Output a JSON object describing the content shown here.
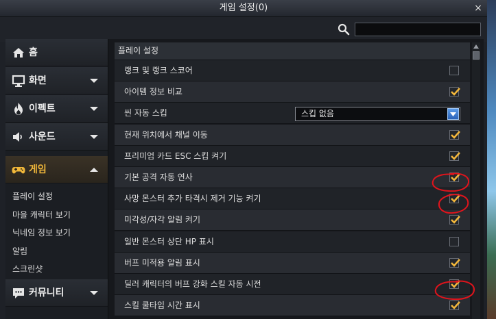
{
  "window": {
    "title": "게임 설정(0)",
    "close_glyph": "×"
  },
  "search": {
    "value": "",
    "placeholder": ""
  },
  "sidebar": {
    "categories": [
      {
        "label": "홈",
        "icon": "home-icon"
      },
      {
        "label": "화면",
        "icon": "monitor-icon"
      },
      {
        "label": "이펙트",
        "icon": "flame-icon"
      },
      {
        "label": "사운드",
        "icon": "speaker-icon"
      },
      {
        "label": "게임",
        "icon": "gamepad-icon"
      },
      {
        "label": "커뮤니티",
        "icon": "chat-icon"
      }
    ],
    "subitems": [
      "플레이 설정",
      "마을 캐릭터 보기",
      "닉네임 정보 보기",
      "알림",
      "스크린샷"
    ]
  },
  "section": {
    "title": "플레이 설정"
  },
  "rows": [
    {
      "label": "랭크 및 랭크 스코어",
      "checked": false
    },
    {
      "label": "아이템 정보 비교",
      "checked": true
    },
    {
      "label": "씬 자동 스킵",
      "dropdown": "스킵 없음"
    },
    {
      "label": "현재 위치에서 채널 이동",
      "checked": true
    },
    {
      "label": "프리미엄 카드 ESC 스킵 켜기",
      "checked": true
    },
    {
      "label": "기본 공격 자동 연사",
      "checked": true
    },
    {
      "label": "사망 몬스터 추가 타격시 제거 기능 켜기",
      "checked": true
    },
    {
      "label": "미각성/자각 알림 켜기",
      "checked": true
    },
    {
      "label": "일반 몬스터 상단 HP 표시",
      "checked": false
    },
    {
      "label": "버프 미적용 알림 표시",
      "checked": true
    },
    {
      "label": "딜러 캐릭터의 버프 강화 스킬 자동 시전",
      "checked": true
    },
    {
      "label": "스킬 쿨타임 시간 표시",
      "checked": true
    }
  ],
  "colors": {
    "accent": "#f0b73a",
    "check": "#f2b63b",
    "annotation": "#e0141c"
  }
}
